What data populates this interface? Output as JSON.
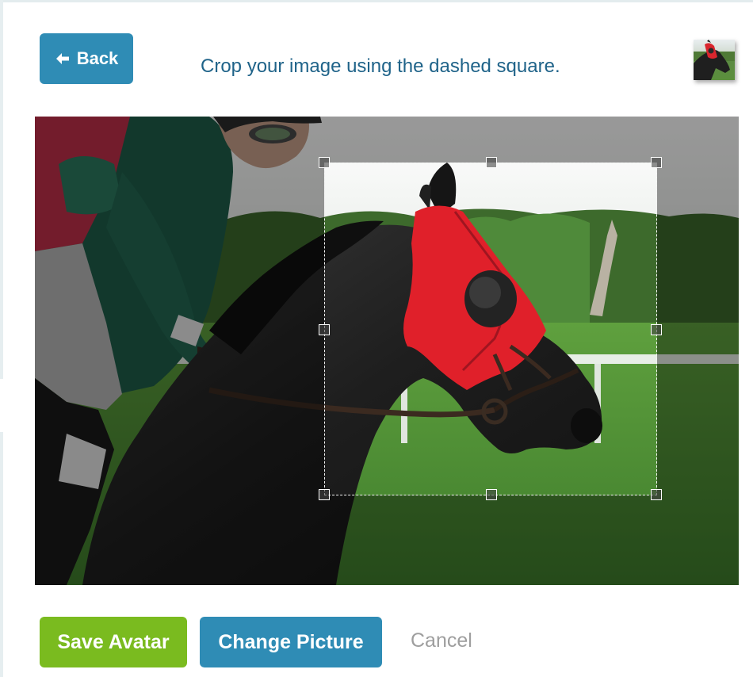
{
  "header": {
    "back_label": "Back",
    "instruction": "Crop your image using the dashed square."
  },
  "preview": {
    "icon": "avatar-preview-thumbnail"
  },
  "actions": {
    "save_label": "Save Avatar",
    "change_label": "Change Picture",
    "cancel_label": "Cancel"
  },
  "icons": {
    "back": "arrow-left-icon"
  },
  "colors": {
    "primary_blue": "#2f8cb5",
    "save_green": "#7abb1f",
    "instruction_text": "#1f6389",
    "cancel_text": "#9e9e9e"
  }
}
